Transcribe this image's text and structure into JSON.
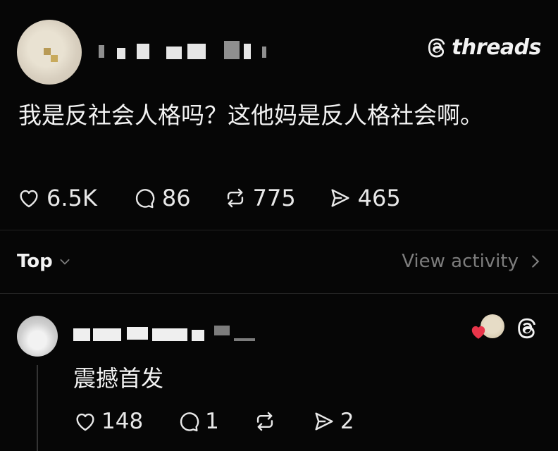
{
  "app": {
    "brand": "threads"
  },
  "post": {
    "text": "我是反社会人格吗？这他妈是反人格社会啊。",
    "likes": "6.5K",
    "replies": "86",
    "reposts": "775",
    "shares": "465"
  },
  "replies_bar": {
    "sort_label": "Top",
    "view_activity": "View activity"
  },
  "comment": {
    "text": "震撼首发",
    "likes": "148",
    "replies": "1",
    "reposts": "",
    "shares": "2"
  },
  "colors": {
    "background": "#060606",
    "text": "#f3f3f3",
    "muted": "#7d7d7d",
    "heart": "#e8354a"
  },
  "icons": [
    "threads-logo-icon",
    "heart-icon",
    "comment-icon",
    "repost-icon",
    "share-icon",
    "chevron-down-icon",
    "chevron-right-icon"
  ]
}
